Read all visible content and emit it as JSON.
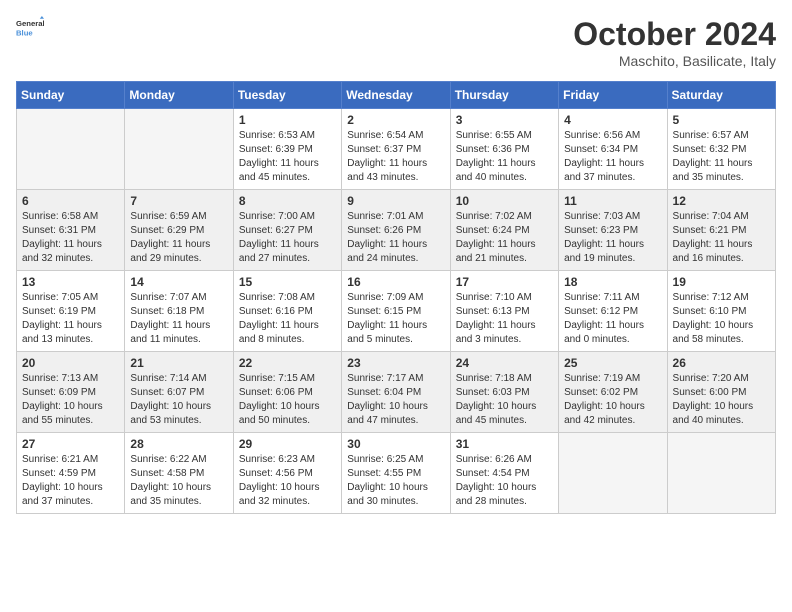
{
  "header": {
    "logo_line1": "General",
    "logo_line2": "Blue",
    "month_title": "October 2024",
    "location": "Maschito, Basilicate, Italy"
  },
  "days_of_week": [
    "Sunday",
    "Monday",
    "Tuesday",
    "Wednesday",
    "Thursday",
    "Friday",
    "Saturday"
  ],
  "weeks": [
    [
      {
        "day": "",
        "empty": true
      },
      {
        "day": "",
        "empty": true
      },
      {
        "day": "1",
        "sunrise": "6:53 AM",
        "sunset": "6:39 PM",
        "daylight": "11 hours and 45 minutes."
      },
      {
        "day": "2",
        "sunrise": "6:54 AM",
        "sunset": "6:37 PM",
        "daylight": "11 hours and 43 minutes."
      },
      {
        "day": "3",
        "sunrise": "6:55 AM",
        "sunset": "6:36 PM",
        "daylight": "11 hours and 40 minutes."
      },
      {
        "day": "4",
        "sunrise": "6:56 AM",
        "sunset": "6:34 PM",
        "daylight": "11 hours and 37 minutes."
      },
      {
        "day": "5",
        "sunrise": "6:57 AM",
        "sunset": "6:32 PM",
        "daylight": "11 hours and 35 minutes."
      }
    ],
    [
      {
        "day": "6",
        "sunrise": "6:58 AM",
        "sunset": "6:31 PM",
        "daylight": "11 hours and 32 minutes."
      },
      {
        "day": "7",
        "sunrise": "6:59 AM",
        "sunset": "6:29 PM",
        "daylight": "11 hours and 29 minutes."
      },
      {
        "day": "8",
        "sunrise": "7:00 AM",
        "sunset": "6:27 PM",
        "daylight": "11 hours and 27 minutes."
      },
      {
        "day": "9",
        "sunrise": "7:01 AM",
        "sunset": "6:26 PM",
        "daylight": "11 hours and 24 minutes."
      },
      {
        "day": "10",
        "sunrise": "7:02 AM",
        "sunset": "6:24 PM",
        "daylight": "11 hours and 21 minutes."
      },
      {
        "day": "11",
        "sunrise": "7:03 AM",
        "sunset": "6:23 PM",
        "daylight": "11 hours and 19 minutes."
      },
      {
        "day": "12",
        "sunrise": "7:04 AM",
        "sunset": "6:21 PM",
        "daylight": "11 hours and 16 minutes."
      }
    ],
    [
      {
        "day": "13",
        "sunrise": "7:05 AM",
        "sunset": "6:19 PM",
        "daylight": "11 hours and 13 minutes."
      },
      {
        "day": "14",
        "sunrise": "7:07 AM",
        "sunset": "6:18 PM",
        "daylight": "11 hours and 11 minutes."
      },
      {
        "day": "15",
        "sunrise": "7:08 AM",
        "sunset": "6:16 PM",
        "daylight": "11 hours and 8 minutes."
      },
      {
        "day": "16",
        "sunrise": "7:09 AM",
        "sunset": "6:15 PM",
        "daylight": "11 hours and 5 minutes."
      },
      {
        "day": "17",
        "sunrise": "7:10 AM",
        "sunset": "6:13 PM",
        "daylight": "11 hours and 3 minutes."
      },
      {
        "day": "18",
        "sunrise": "7:11 AM",
        "sunset": "6:12 PM",
        "daylight": "11 hours and 0 minutes."
      },
      {
        "day": "19",
        "sunrise": "7:12 AM",
        "sunset": "6:10 PM",
        "daylight": "10 hours and 58 minutes."
      }
    ],
    [
      {
        "day": "20",
        "sunrise": "7:13 AM",
        "sunset": "6:09 PM",
        "daylight": "10 hours and 55 minutes."
      },
      {
        "day": "21",
        "sunrise": "7:14 AM",
        "sunset": "6:07 PM",
        "daylight": "10 hours and 53 minutes."
      },
      {
        "day": "22",
        "sunrise": "7:15 AM",
        "sunset": "6:06 PM",
        "daylight": "10 hours and 50 minutes."
      },
      {
        "day": "23",
        "sunrise": "7:17 AM",
        "sunset": "6:04 PM",
        "daylight": "10 hours and 47 minutes."
      },
      {
        "day": "24",
        "sunrise": "7:18 AM",
        "sunset": "6:03 PM",
        "daylight": "10 hours and 45 minutes."
      },
      {
        "day": "25",
        "sunrise": "7:19 AM",
        "sunset": "6:02 PM",
        "daylight": "10 hours and 42 minutes."
      },
      {
        "day": "26",
        "sunrise": "7:20 AM",
        "sunset": "6:00 PM",
        "daylight": "10 hours and 40 minutes."
      }
    ],
    [
      {
        "day": "27",
        "sunrise": "6:21 AM",
        "sunset": "4:59 PM",
        "daylight": "10 hours and 37 minutes."
      },
      {
        "day": "28",
        "sunrise": "6:22 AM",
        "sunset": "4:58 PM",
        "daylight": "10 hours and 35 minutes."
      },
      {
        "day": "29",
        "sunrise": "6:23 AM",
        "sunset": "4:56 PM",
        "daylight": "10 hours and 32 minutes."
      },
      {
        "day": "30",
        "sunrise": "6:25 AM",
        "sunset": "4:55 PM",
        "daylight": "10 hours and 30 minutes."
      },
      {
        "day": "31",
        "sunrise": "6:26 AM",
        "sunset": "4:54 PM",
        "daylight": "10 hours and 28 minutes."
      },
      {
        "day": "",
        "empty": true
      },
      {
        "day": "",
        "empty": true
      }
    ]
  ],
  "labels": {
    "sunrise": "Sunrise:",
    "sunset": "Sunset:",
    "daylight": "Daylight:"
  }
}
